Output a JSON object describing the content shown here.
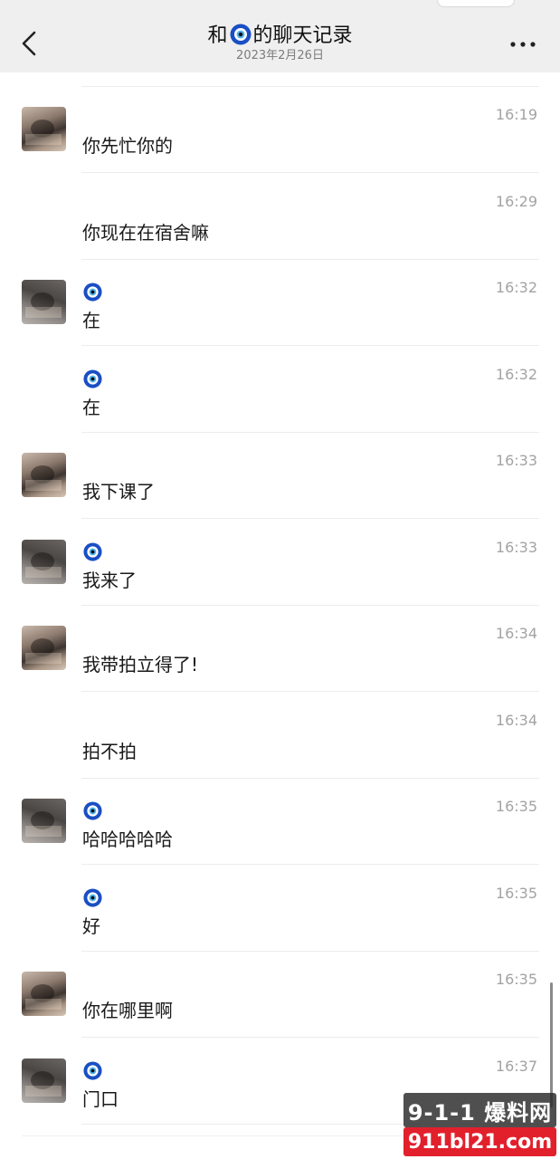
{
  "header": {
    "title_prefix": "和",
    "title_suffix": "的聊天记录",
    "date": "2023年2月26日"
  },
  "messages": [
    {
      "sender": "a",
      "time": "16:19",
      "text": "你先忙你的",
      "show_avatar": true,
      "show_icon": false
    },
    {
      "sender": "a",
      "time": "16:29",
      "text": "你现在在宿舍嘛",
      "show_avatar": false,
      "show_icon": false
    },
    {
      "sender": "b",
      "time": "16:32",
      "text": "在",
      "show_avatar": true,
      "show_icon": true
    },
    {
      "sender": "b",
      "time": "16:32",
      "text": "在",
      "show_avatar": false,
      "show_icon": true
    },
    {
      "sender": "a",
      "time": "16:33",
      "text": "我下课了",
      "show_avatar": true,
      "show_icon": false
    },
    {
      "sender": "b",
      "time": "16:33",
      "text": "我来了",
      "show_avatar": true,
      "show_icon": true
    },
    {
      "sender": "a",
      "time": "16:34",
      "text": "我带拍立得了!",
      "show_avatar": true,
      "show_icon": false
    },
    {
      "sender": "a",
      "time": "16:34",
      "text": "拍不拍",
      "show_avatar": false,
      "show_icon": false
    },
    {
      "sender": "b",
      "time": "16:35",
      "text": "哈哈哈哈哈",
      "show_avatar": true,
      "show_icon": true
    },
    {
      "sender": "b",
      "time": "16:35",
      "text": "好",
      "show_avatar": false,
      "show_icon": true
    },
    {
      "sender": "a",
      "time": "16:35",
      "text": "你在哪里啊",
      "show_avatar": true,
      "show_icon": false
    },
    {
      "sender": "b",
      "time": "16:37",
      "text": "门口",
      "show_avatar": true,
      "show_icon": true
    }
  ],
  "icons": {
    "back": "chevron-left-icon",
    "more": "more-dots-icon",
    "sender_badge": "evil-eye-icon"
  },
  "colors": {
    "header_bg": "#efefef",
    "time_text": "#a3a3a3",
    "badge_blue": "#1a4fc4"
  },
  "watermark": {
    "top": "9-1-1 爆料网",
    "bottom": "911bl21.com"
  }
}
